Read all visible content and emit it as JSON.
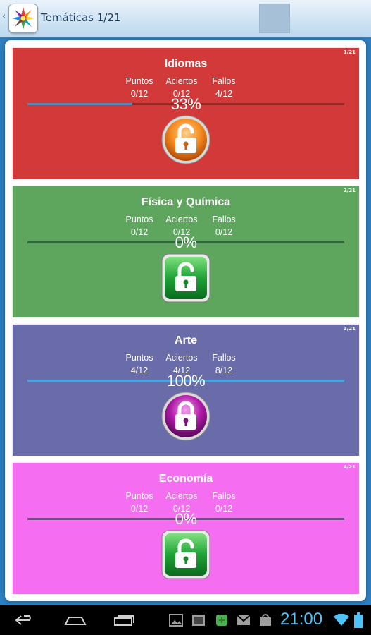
{
  "header": {
    "title": "Temáticas 1/21"
  },
  "cards": [
    {
      "index": "1/21",
      "title": "Idiomas",
      "color": "#d23a3a",
      "labels": [
        "Puntos",
        "Aciertos",
        "Fallos"
      ],
      "values": [
        "0/12",
        "0/12",
        "4/12"
      ],
      "percent": "33%",
      "progress": 0.33,
      "track_color": "#9a2424",
      "fill_color": "#5b87b7",
      "button": "lock-open-orange"
    },
    {
      "index": "2/21",
      "title": "Física y Química",
      "color": "#5ea65e",
      "labels": [
        "Puntos",
        "Aciertos",
        "Fallos"
      ],
      "values": [
        "0/12",
        "0/12",
        "0/12"
      ],
      "percent": "0%",
      "progress": 0,
      "track_color": "#2f6b3a",
      "fill_color": "#5b87b7",
      "button": "lock-open-green"
    },
    {
      "index": "3/21",
      "title": "Arte",
      "color": "#6a6caa",
      "labels": [
        "Puntos",
        "Aciertos",
        "Fallos"
      ],
      "values": [
        "4/12",
        "4/12",
        "8/12"
      ],
      "percent": "100%",
      "progress": 1.0,
      "track_color": "#3e3f78",
      "fill_color": "#4aa3e0",
      "button": "lock-closed-purple"
    },
    {
      "index": "4/21",
      "title": "Economía",
      "color": "#f56ef2",
      "labels": [
        "Puntos",
        "Aciertos",
        "Fallos"
      ],
      "values": [
        "0/12",
        "0/12",
        "0/12"
      ],
      "percent": "0%",
      "progress": 0,
      "track_color": "#7a4a86",
      "fill_color": "#5b87b7",
      "button": "lock-open-green"
    }
  ],
  "statusbar": {
    "time": "21:00"
  }
}
